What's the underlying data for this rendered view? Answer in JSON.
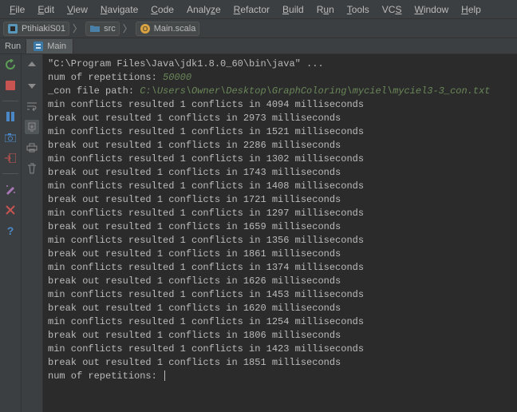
{
  "menu": {
    "file": "File",
    "edit": "Edit",
    "view": "View",
    "navigate": "Navigate",
    "code": "Code",
    "analyze": "Analyze",
    "refactor": "Refactor",
    "build": "Build",
    "run": "Run",
    "tools": "Tools",
    "vcs": "VCS",
    "window": "Window",
    "help": "Help"
  },
  "breadcrumb": {
    "project": "PtihiakiS01",
    "src": "src",
    "file": "Main.scala"
  },
  "tabs": {
    "run": "Run",
    "main": "Main"
  },
  "console": {
    "cmd": "\"C:\\Program Files\\Java\\jdk1.8.0_60\\bin\\java\" ...",
    "rep_label": "num of repetitions: ",
    "rep_value": "50000",
    "path_label": "_con file path: ",
    "path_value": "C:\\Users\\Owner\\Desktop\\GraphColoring\\myciel\\myciel3-3_con.txt",
    "lines": [
      "min conflicts resulted 1 conflicts in 4094 milliseconds",
      "break out resulted 1 conflicts in 2973 milliseconds",
      "min conflicts resulted 1 conflicts in 1521 milliseconds",
      "break out resulted 1 conflicts in 2286 milliseconds",
      "min conflicts resulted 1 conflicts in 1302 milliseconds",
      "break out resulted 1 conflicts in 1743 milliseconds",
      "min conflicts resulted 1 conflicts in 1408 milliseconds",
      "break out resulted 1 conflicts in 1721 milliseconds",
      "min conflicts resulted 1 conflicts in 1297 milliseconds",
      "break out resulted 1 conflicts in 1659 milliseconds",
      "min conflicts resulted 1 conflicts in 1356 milliseconds",
      "break out resulted 1 conflicts in 1861 milliseconds",
      "min conflicts resulted 1 conflicts in 1374 milliseconds",
      "break out resulted 1 conflicts in 1626 milliseconds",
      "min conflicts resulted 1 conflicts in 1453 milliseconds",
      "break out resulted 1 conflicts in 1620 milliseconds",
      "min conflicts resulted 1 conflicts in 1254 milliseconds",
      "break out resulted 1 conflicts in 1806 milliseconds",
      "min conflicts resulted 1 conflicts in 1423 milliseconds",
      "break out resulted 1 conflicts in 1851 milliseconds"
    ],
    "prompt": "num of repetitions: "
  }
}
